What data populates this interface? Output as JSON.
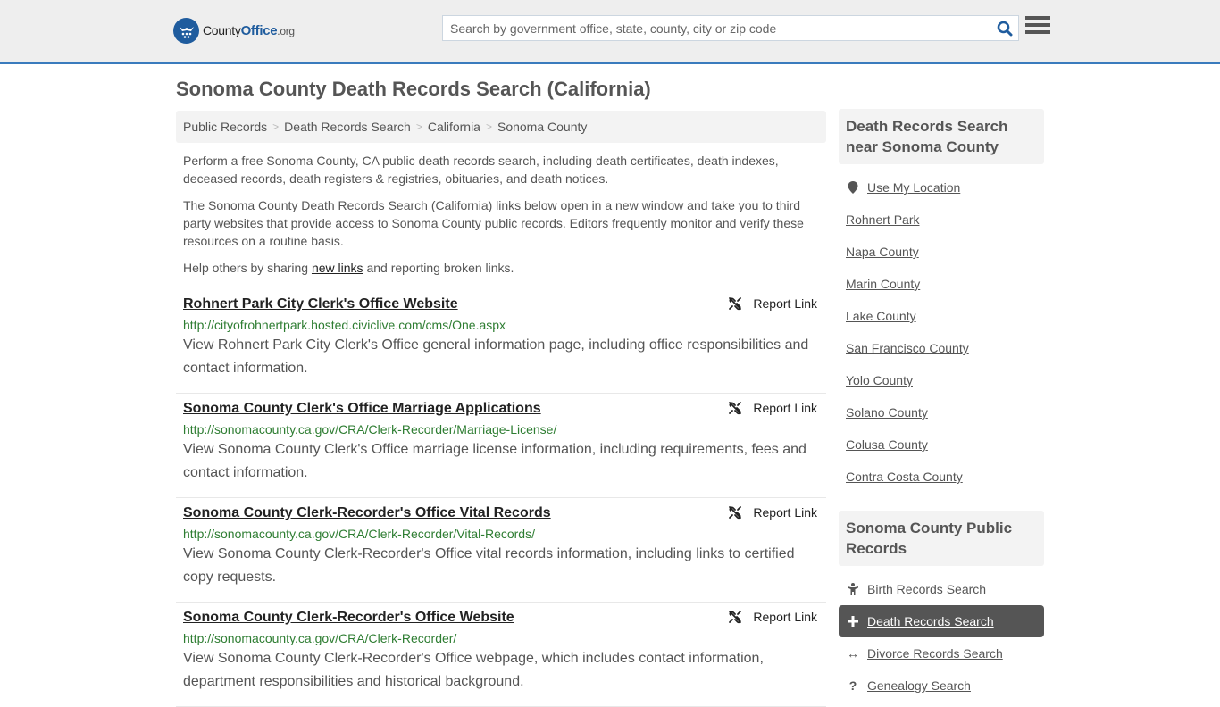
{
  "header": {
    "logo": {
      "brand_county": "County",
      "brand_office": "Office",
      "brand_tld": ".org",
      "icon": "eagle-stars-icon"
    },
    "search": {
      "placeholder": "Search by government office, state, county, city or zip code",
      "value": "",
      "icon": "search-icon"
    },
    "menu_icon": "hamburger-menu-icon",
    "accent_color": "#3a7bbd"
  },
  "page": {
    "title": "Sonoma County Death Records Search (California)"
  },
  "breadcrumb": [
    {
      "label": "Public Records"
    },
    {
      "label": "Death Records Search"
    },
    {
      "label": "California"
    },
    {
      "label": "Sonoma County"
    }
  ],
  "intro": {
    "p1": "Perform a free Sonoma County, CA public death records search, including death certificates, death indexes, deceased records, death registers & registries, obituaries, and death notices.",
    "p2": "The Sonoma County Death Records Search (California) links below open in a new window and take you to third party websites that provide access to Sonoma County public records. Editors frequently monitor and verify these resources on a routine basis.",
    "p3_before": "Help others by sharing ",
    "p3_link": "new links",
    "p3_after": " and reporting broken links."
  },
  "results": [
    {
      "title": "Rohnert Park City Clerk's Office Website",
      "url": "http://cityofrohnertpark.hosted.civiclive.com/cms/One.aspx",
      "description": "View Rohnert Park City Clerk's Office general information page, including office responsibilities and contact information.",
      "report_label": "Report Link"
    },
    {
      "title": "Sonoma County Clerk's Office Marriage Applications",
      "url": "http://sonomacounty.ca.gov/CRA/Clerk-Recorder/Marriage-License/",
      "description": "View Sonoma County Clerk's Office marriage license information, including requirements, fees and contact information.",
      "report_label": "Report Link"
    },
    {
      "title": "Sonoma County Clerk-Recorder's Office Vital Records",
      "url": "http://sonomacounty.ca.gov/CRA/Clerk-Recorder/Vital-Records/",
      "description": "View Sonoma County Clerk-Recorder's Office vital records information, including links to certified copy requests.",
      "report_label": "Report Link"
    },
    {
      "title": "Sonoma County Clerk-Recorder's Office Website",
      "url": "http://sonomacounty.ca.gov/CRA/Clerk-Recorder/",
      "description": "View Sonoma County Clerk-Recorder's Office webpage, which includes contact information, department responsibilities and historical background.",
      "report_label": "Report Link"
    }
  ],
  "sidebar": {
    "nearby": {
      "heading": "Death Records Search near Sonoma County",
      "use_location": "Use My Location",
      "items": [
        "Rohnert Park",
        "Napa County",
        "Marin County",
        "Lake County",
        "San Francisco County",
        "Yolo County",
        "Solano County",
        "Colusa County",
        "Contra Costa County"
      ]
    },
    "public_records": {
      "heading": "Sonoma County Public Records",
      "items": [
        {
          "label": "Birth Records Search",
          "icon": "child-icon",
          "active": false
        },
        {
          "label": "Death Records Search",
          "icon": "plus-icon",
          "active": true
        },
        {
          "label": "Divorce Records Search",
          "icon": "arrows-horizontal-icon",
          "active": false
        },
        {
          "label": "Genealogy Search",
          "icon": "question-icon",
          "active": false
        }
      ]
    }
  }
}
